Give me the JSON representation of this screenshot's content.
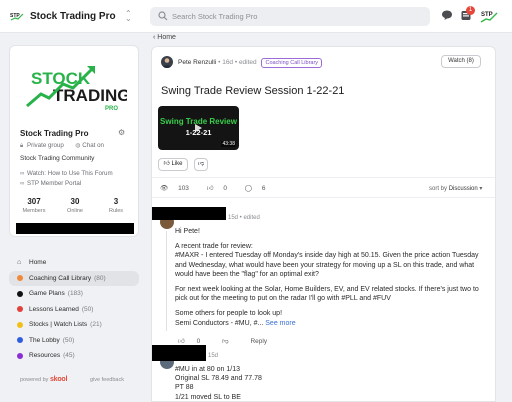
{
  "header": {
    "app_title": "Stock Trading Pro",
    "search_placeholder": "Search Stock Trading Pro",
    "notification_count": "1",
    "switcher_glyph": "⌃⌄"
  },
  "sidebar": {
    "logo_text_top": "STOCK",
    "logo_text_bottom": "TRADING",
    "logo_text_sub": "PRO",
    "group_name": "Stock Trading Pro",
    "privacy": "Private group",
    "chat": "Chat on",
    "community": "Stock Trading Community",
    "links": [
      "Watch: How to Use This Forum",
      "STP Member Portal"
    ],
    "stats": [
      {
        "value": "307",
        "label": "Members"
      },
      {
        "value": "30",
        "label": "Online"
      },
      {
        "value": "3",
        "label": "Rules"
      }
    ],
    "nav": [
      {
        "label": "Home",
        "count": "",
        "color": ""
      },
      {
        "label": "Coaching Call Library",
        "count": "(80)",
        "color": "#f08a3a",
        "active": true
      },
      {
        "label": "Game Plans",
        "count": "(183)",
        "color": "#111111"
      },
      {
        "label": "Lessons Learned",
        "count": "(50)",
        "color": "#e0413a"
      },
      {
        "label": "Stocks | Watch Lists",
        "count": "(21)",
        "color": "#f0c018"
      },
      {
        "label": "The Lobby",
        "count": "(50)",
        "color": "#2f5de0"
      },
      {
        "label": "Resources",
        "count": "(45)",
        "color": "#8a2fd6"
      }
    ],
    "powered_by": "powered by",
    "brand": "skool",
    "give_feedback": "give feedback"
  },
  "breadcrumb": "Home",
  "post": {
    "author": "Pete Renzulli",
    "time": "• 16d • edited",
    "category": "Coaching Call Library",
    "watch_label": "Watch (8)",
    "title": "Swing Trade Review Session 1-22-21",
    "video_title_line1": "Swing Trade Review",
    "video_title_line2": "1-22-21",
    "video_duration": "43:38",
    "like_label": "Like",
    "views": "103",
    "likes": "0",
    "comments": "6",
    "sort_label": "sort by",
    "sort_value": "Discussion"
  },
  "comments": [
    {
      "time": "15d • edited",
      "paragraphs": [
        "Hi Pete!",
        "A recent trade for review:",
        "#MAXR - I entered Tuesday off Monday's inside day high at 50.15. Given the price action Tuesday and Wednesday, what would have been your strategy for moving up a SL on this trade, and what would have been the \"flag\" for an optimal exit?",
        "For next week looking at the Solar, Home Builders, EV, and EV related stocks. If there's just two to pick out for the meeting to put on the radar I'll go with #PLL and #FUV",
        "Some others for people to look up!"
      ],
      "last_line": "Semi Conductors - #MU, #...",
      "see_more": "See more",
      "likes": "0",
      "reply_label": "Reply"
    },
    {
      "time": "15d",
      "lines": [
        "#MU in at 80 on 1/13",
        "Original SL 78.49 and 77.78",
        "PT 88",
        "1/21 moved SL to BE"
      ]
    }
  ]
}
